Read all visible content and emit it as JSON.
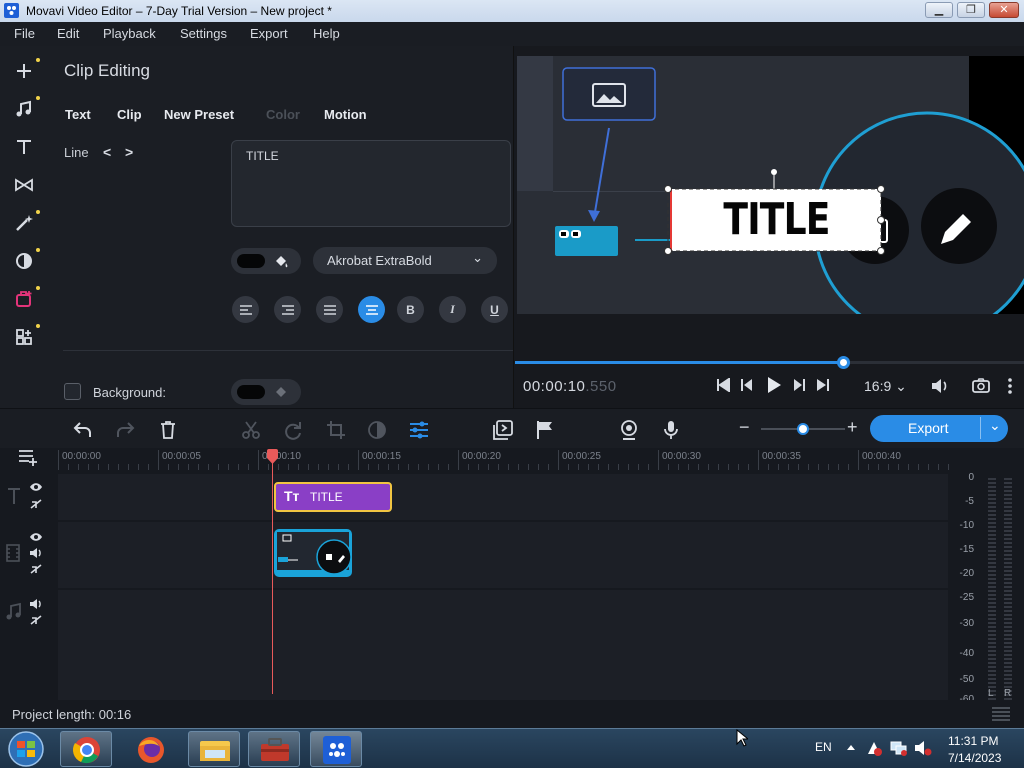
{
  "window": {
    "title": "Movavi Video Editor – 7-Day Trial Version – New project *",
    "minimize": "▁",
    "restore": "❐",
    "close": "✕"
  },
  "menu": [
    "File",
    "Edit",
    "Playback",
    "Settings",
    "Export",
    "Help"
  ],
  "left_tools": [
    "add-icon",
    "music-icon",
    "text-icon",
    "transitions-icon",
    "magic-icon",
    "filters-icon",
    "stickers-icon",
    "more-tools-icon"
  ],
  "clip_editing": {
    "header": "Clip Editing",
    "tabs": [
      "Text",
      "Clip",
      "New Preset",
      "Color",
      "Motion"
    ],
    "line_label": "Line",
    "line_prev": "<",
    "line_next": ">",
    "text_value": "TITLE",
    "font": "Akrobat ExtraBold",
    "font_chevron": "⌄",
    "format_buttons": [
      "align-left",
      "align-right",
      "justify",
      "align-center",
      "B",
      "I",
      "U"
    ],
    "background_label": "Background:"
  },
  "preview": {
    "title_text": "TITLE",
    "time_main": "00:00:10",
    "time_ms": ".550",
    "aspect": "16:9",
    "aspect_chevron": "⌄",
    "progress": 0.645
  },
  "toolbar": {
    "export_label": "Export",
    "export_chevron": "⌄",
    "zoom": 0.5,
    "zoom_minus": "−",
    "zoom_plus": "+"
  },
  "ruler_ticks": [
    "00:00:00",
    "00:00:05",
    "00:00:10",
    "00:00:15",
    "00:00:20",
    "00:00:25",
    "00:00:30",
    "00:00:35",
    "00:00:40"
  ],
  "title_clip": {
    "label": "TITLE",
    "icon": "Tт"
  },
  "meter_labels": [
    "0",
    "-5",
    "-10",
    "-15",
    "-20",
    "-25",
    "-30",
    "-40",
    "-50",
    "-60"
  ],
  "meter_channels": [
    "L",
    "R"
  ],
  "status": {
    "project_length": "Project length: 00:16"
  },
  "tray": {
    "lang": "EN",
    "time": "11:31 PM",
    "date": "7/14/2023"
  },
  "colors": {
    "accent": "#2a8ce6",
    "title_clip": "#8a3fc6",
    "playhead": "#e85a5a",
    "video_clip": "#1aa3d9"
  }
}
